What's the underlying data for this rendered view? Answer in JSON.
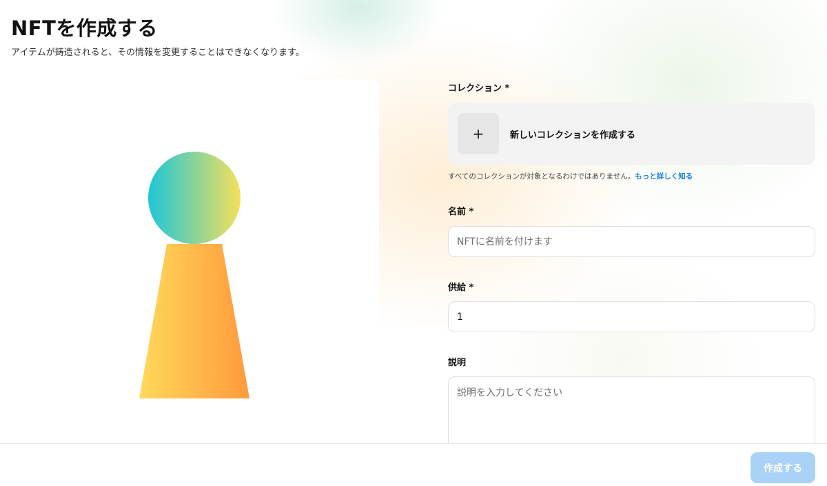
{
  "header": {
    "title": "NFTを作成する",
    "subtitle": "アイテムが鋳造されると、その情報を変更することはできなくなります。"
  },
  "preview": {
    "image": "nft-placeholder-illustration",
    "colors": {
      "circle_start": "#1ec6d8",
      "circle_end": "#f5e05a",
      "body_start": "#ffd95a",
      "body_end": "#ff9a3c"
    }
  },
  "form": {
    "collection": {
      "label": "コレクション *",
      "create_label": "新しいコレクションを作成する",
      "plus_icon": "+",
      "helper_text": "すべてのコレクションが対象となるわけではありません。",
      "learn_more": "もっと詳しく知る"
    },
    "name": {
      "label": "名前 *",
      "placeholder": "NFTに名前を付けます",
      "value": ""
    },
    "supply": {
      "label": "供給 *",
      "value": "1"
    },
    "description": {
      "label": "説明",
      "placeholder": "説明を入力してください",
      "value": ""
    }
  },
  "footer": {
    "create_button": "作成する"
  },
  "colors": {
    "accent": "#2081e2",
    "button_disabled": "#a9d2f6"
  }
}
